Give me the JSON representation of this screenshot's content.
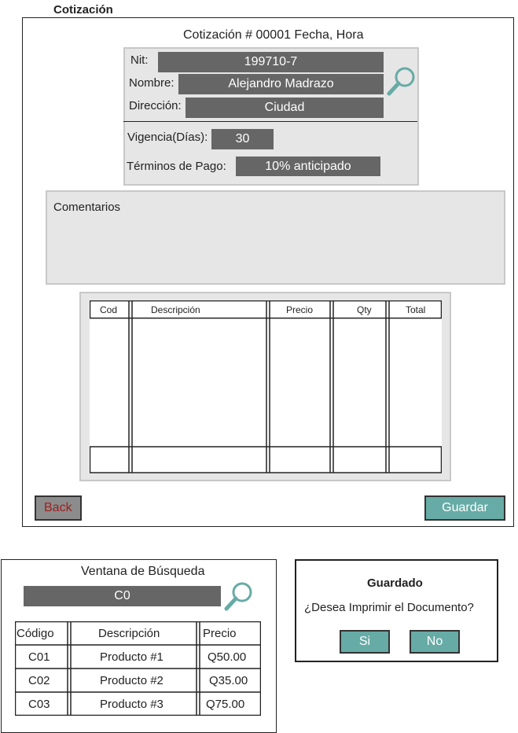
{
  "page_title": "Cotización",
  "quote": {
    "header": "Cotización # 00001 Fecha, Hora",
    "nit_label": "Nit:",
    "nit_value": "199710-7",
    "nombre_label": "Nombre:",
    "nombre_value": "Alejandro Madrazo",
    "direccion_label": "Dirección:",
    "direccion_value": "Ciudad",
    "vigencia_label": "Vigencia(Días):",
    "vigencia_value": "30",
    "terminos_label": "Términos de Pago:",
    "terminos_value": "10% anticipado",
    "comentarios_label": "Comentarios",
    "table_headers": [
      "Cod",
      "Descripción",
      "Precio",
      "Qty",
      "Total"
    ],
    "back_label": "Back",
    "save_label": "Guardar"
  },
  "search_window": {
    "title": "Ventana de Búsqueda",
    "search_value": "C0",
    "headers": [
      "Código",
      "Descripción",
      "Precio"
    ],
    "rows": [
      [
        "C01",
        "Producto #1",
        "Q50.00"
      ],
      [
        "C02",
        "Producto #2",
        "Q35.00"
      ],
      [
        "C03",
        "Producto #3",
        "Q75.00"
      ]
    ]
  },
  "saved_dialog": {
    "title": "Guardado",
    "message": "¿Desea Imprimir el Documento?",
    "yes_label": "Si",
    "no_label": "No"
  },
  "icons": {
    "search": "magnifier-icon"
  },
  "colors": {
    "field_bg": "#666666",
    "panel_bg": "#e6e6e6",
    "teal": "#67aba6",
    "back_text": "#a11e1e"
  }
}
